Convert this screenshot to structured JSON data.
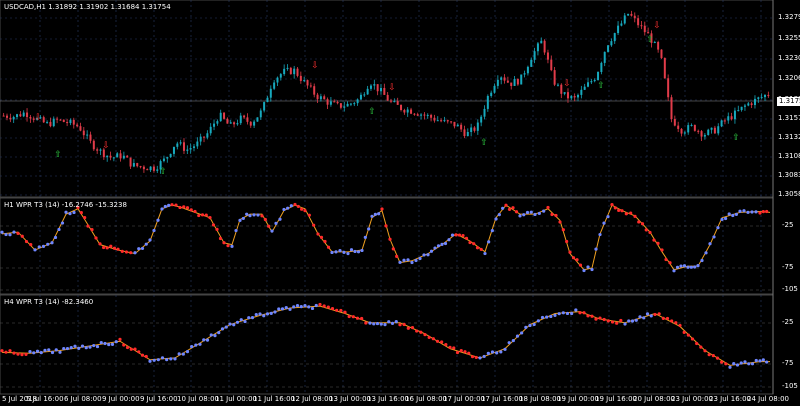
{
  "main": {
    "title": "USDCAD,H1  1.31892 1.31902 1.31684 1.31754",
    "current_price": "1.31754",
    "y_labels": [
      "1.32795",
      "1.32550",
      "1.32305",
      "1.32060",
      "1.31815",
      "1.31570",
      "1.31325",
      "1.31080",
      "1.30835",
      "1.30585"
    ]
  },
  "ind1": {
    "title": "H1 WPR T3 (14) -16.2746 -15.3238",
    "y_labels": [
      "-25",
      "-75",
      "-105"
    ]
  },
  "ind2": {
    "title": "H4 WPR T3 (14) -82.3460",
    "y_labels": [
      "-25",
      "-75",
      "-105"
    ]
  },
  "x_labels": [
    "5 Jul 2018",
    "5 Jul 16:00",
    "6 Jul 08:00",
    "9 Jul 00:00",
    "9 Jul 16:00",
    "10 Jul 08:00",
    "11 Jul 00:00",
    "11 Jul 16:00",
    "12 Jul 08:00",
    "13 Jul 00:00",
    "13 Jul 16:00",
    "16 Jul 08:00",
    "17 Jul 00:00",
    "17 Jul 16:00",
    "18 Jul 08:00",
    "19 Jul 00:00",
    "19 Jul 16:00",
    "20 Jul 08:00",
    "23 Jul 00:00",
    "23 Jul 16:00",
    "24 Jul 08:00"
  ],
  "colors": {
    "bull": "#17a9bd",
    "bear": "#e23c4a",
    "grid": "#2a3a66",
    "signal_line": "#f0a020",
    "dot_up": "#6f86ff",
    "dot_down": "#ff2a2a",
    "up_arrow": "#2ecc40",
    "down_arrow": "#ff3030"
  },
  "chart_data": [
    {
      "type": "candlestick",
      "title": "USDCAD,H1  1.31892 1.31902 1.31684 1.31754",
      "ylim": [
        1.3056,
        1.3292
      ],
      "close_series": [
        1.3154,
        1.3153,
        1.3158,
        1.315,
        1.3143,
        1.3148,
        1.3145,
        1.314,
        1.312,
        1.3108,
        1.31,
        1.3103,
        1.309,
        1.3088,
        1.3087,
        1.3098,
        1.312,
        1.311,
        1.3118,
        1.3132,
        1.3155,
        1.314,
        1.315,
        1.3145,
        1.316,
        1.32,
        1.321,
        1.3212,
        1.3195,
        1.318,
        1.3172,
        1.3166,
        1.3168,
        1.3175,
        1.3198,
        1.3185,
        1.317,
        1.3163,
        1.316,
        1.3155,
        1.315,
        1.3145,
        1.3142,
        1.313,
        1.314,
        1.318,
        1.3208,
        1.3195,
        1.32,
        1.323,
        1.325,
        1.32,
        1.318,
        1.3175,
        1.319,
        1.3205,
        1.3245,
        1.3265,
        1.3285,
        1.327,
        1.3255,
        1.323,
        1.315,
        1.3135,
        1.314,
        1.313,
        1.3135,
        1.3148,
        1.3157,
        1.3168,
        1.3175,
        1.3182
      ],
      "signals_down_arrows": 6,
      "signals_up_arrows": 7
    },
    {
      "type": "line",
      "title": "H1 WPR T3 (14) -16.2746 -15.3238",
      "ylim": [
        -107,
        0
      ],
      "values": [
        -16.2746,
        -15.3238
      ]
    },
    {
      "type": "line",
      "title": "H4 WPR T3 (14) -82.3460",
      "ylim": [
        -107,
        0
      ],
      "values": [
        -82.346
      ]
    }
  ]
}
